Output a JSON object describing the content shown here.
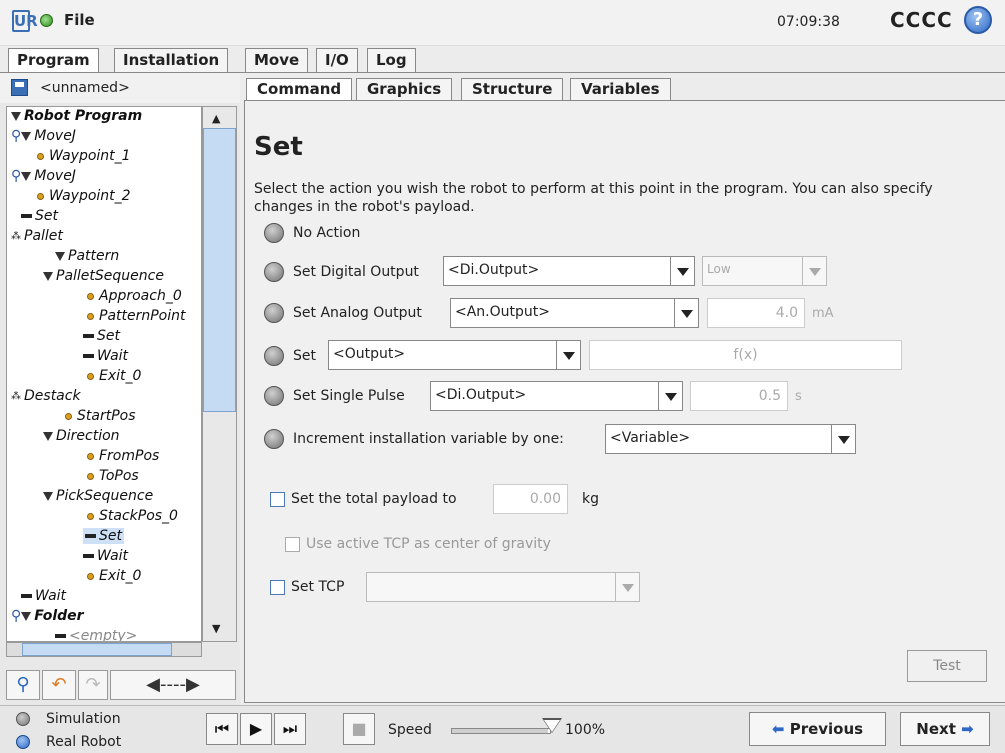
{
  "app": {
    "logo": "UR",
    "file_menu": "File",
    "clock": "07:09:38",
    "robot_name": "CCCC",
    "help_glyph": "?"
  },
  "main_tabs": [
    {
      "label": "Program",
      "active": true
    },
    {
      "label": "Installation",
      "active": false
    },
    {
      "label": "Move",
      "active": false
    },
    {
      "label": "I/O",
      "active": false
    },
    {
      "label": "Log",
      "active": false
    }
  ],
  "program": {
    "name": "<unnamed>"
  },
  "tree": [
    {
      "label": "Robot Program",
      "icon": "triangle-icon",
      "bold": true
    },
    {
      "label": "MoveJ",
      "icon": "triangle-icon"
    },
    {
      "label": "Waypoint_1",
      "icon": "waypoint-icon"
    },
    {
      "label": "MoveJ",
      "icon": "triangle-icon"
    },
    {
      "label": "Waypoint_2",
      "icon": "waypoint-icon"
    },
    {
      "label": "Set",
      "icon": "bar-icon"
    },
    {
      "label": "Pallet",
      "icon": "pallet-icon"
    },
    {
      "label": "Pattern",
      "icon": "triangle-icon"
    },
    {
      "label": "PalletSequence",
      "icon": "triangle-icon"
    },
    {
      "label": "Approach_0",
      "icon": "waypoint-icon"
    },
    {
      "label": "PatternPoint",
      "icon": "waypoint-icon"
    },
    {
      "label": "Set",
      "icon": "bar-icon"
    },
    {
      "label": "Wait",
      "icon": "bar-icon"
    },
    {
      "label": "Exit_0",
      "icon": "waypoint-icon"
    },
    {
      "label": "Destack",
      "icon": "pallet-icon"
    },
    {
      "label": "StartPos",
      "icon": "waypoint-icon"
    },
    {
      "label": "Direction",
      "icon": "triangle-icon"
    },
    {
      "label": "FromPos",
      "icon": "waypoint-icon"
    },
    {
      "label": "ToPos",
      "icon": "waypoint-icon"
    },
    {
      "label": "PickSequence",
      "icon": "triangle-icon"
    },
    {
      "label": "StackPos_0",
      "icon": "waypoint-icon"
    },
    {
      "label": "Set",
      "icon": "bar-icon",
      "selected": true
    },
    {
      "label": "Wait",
      "icon": "bar-icon"
    },
    {
      "label": "Exit_0",
      "icon": "waypoint-icon"
    },
    {
      "label": "Wait",
      "icon": "bar-icon"
    },
    {
      "label": "Folder",
      "icon": "triangle-icon",
      "bold": true
    },
    {
      "label": "<empty>",
      "icon": "bar-icon",
      "empty": true
    }
  ],
  "sub_tabs": [
    {
      "label": "Command",
      "active": true
    },
    {
      "label": "Graphics",
      "active": false
    },
    {
      "label": "Structure",
      "active": false
    },
    {
      "label": "Variables",
      "active": false
    }
  ],
  "set_panel": {
    "title": "Set",
    "description": "Select the action you wish the robot to perform at this point in the program. You can also specify changes in the robot's payload.",
    "no_action": "No Action",
    "digital_output": {
      "label": "Set Digital Output",
      "value": "<Di.Output>",
      "state": "Low"
    },
    "analog_output": {
      "label": "Set Analog Output",
      "value": "<An.Output>",
      "amount": "4.0",
      "unit": "mA"
    },
    "set_expr": {
      "label": "Set",
      "value": "<Output>",
      "expr": "f(x)"
    },
    "single_pulse": {
      "label": "Set Single Pulse",
      "value": "<Di.Output>",
      "duration": "0.5",
      "unit": "s"
    },
    "increment": {
      "label": "Increment installation variable by one:",
      "value": "<Variable>"
    },
    "payload": {
      "label": "Set the total payload to",
      "value": "0.00",
      "unit": "kg"
    },
    "use_tcp": "Use active TCP as center of gravity",
    "set_tcp": {
      "label": "Set TCP",
      "value": ""
    },
    "test_button": "Test"
  },
  "bottom": {
    "simulation": "Simulation",
    "real_robot": "Real Robot",
    "speed_label": "Speed",
    "speed_value": "100%",
    "speed_fraction": 1.0,
    "previous": "Previous",
    "next": "Next"
  }
}
